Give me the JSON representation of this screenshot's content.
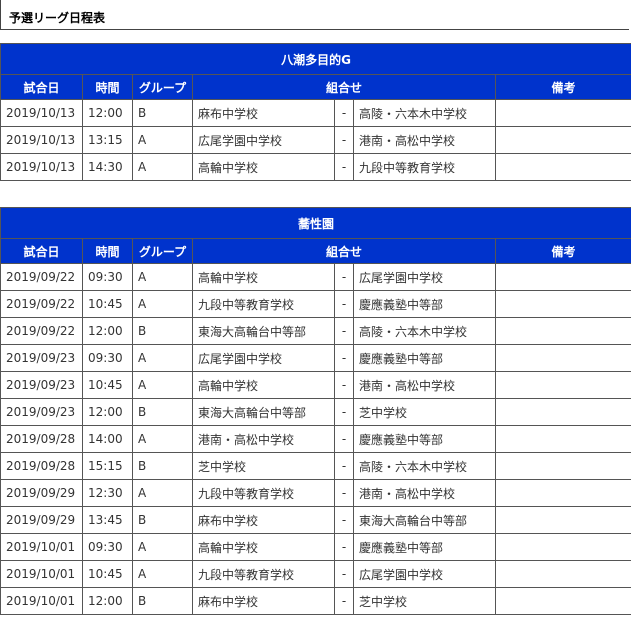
{
  "page_title": "予選リーグ日程表",
  "headers": {
    "date": "試合日",
    "time": "時間",
    "group": "グループ",
    "match": "組合せ",
    "note": "備考"
  },
  "venues": [
    {
      "name": "八潮多目的G",
      "rows": [
        {
          "date": "2019/10/13",
          "time": "12:00",
          "group": "B",
          "team1": "麻布中学校",
          "sep": "-",
          "team2": "高陵・六本木中学校",
          "note": ""
        },
        {
          "date": "2019/10/13",
          "time": "13:15",
          "group": "A",
          "team1": "広尾学園中学校",
          "sep": "-",
          "team2": "港南・高松中学校",
          "note": ""
        },
        {
          "date": "2019/10/13",
          "time": "14:30",
          "group": "A",
          "team1": "高輪中学校",
          "sep": "-",
          "team2": "九段中等教育学校",
          "note": ""
        }
      ]
    },
    {
      "name": "蕎性園",
      "rows": [
        {
          "date": "2019/09/22",
          "time": "09:30",
          "group": "A",
          "team1": "高輪中学校",
          "sep": "-",
          "team2": "広尾学園中学校",
          "note": ""
        },
        {
          "date": "2019/09/22",
          "time": "10:45",
          "group": "A",
          "team1": "九段中等教育学校",
          "sep": "-",
          "team2": "慶應義塾中等部",
          "note": ""
        },
        {
          "date": "2019/09/22",
          "time": "12:00",
          "group": "B",
          "team1": "東海大高輪台中等部",
          "sep": "-",
          "team2": "高陵・六本木中学校",
          "note": ""
        },
        {
          "date": "2019/09/23",
          "time": "09:30",
          "group": "A",
          "team1": "広尾学園中学校",
          "sep": "-",
          "team2": "慶應義塾中等部",
          "note": ""
        },
        {
          "date": "2019/09/23",
          "time": "10:45",
          "group": "A",
          "team1": "高輪中学校",
          "sep": "-",
          "team2": "港南・高松中学校",
          "note": ""
        },
        {
          "date": "2019/09/23",
          "time": "12:00",
          "group": "B",
          "team1": "東海大高輪台中等部",
          "sep": "-",
          "team2": "芝中学校",
          "note": ""
        },
        {
          "date": "2019/09/28",
          "time": "14:00",
          "group": "A",
          "team1": "港南・高松中学校",
          "sep": "-",
          "team2": "慶應義塾中等部",
          "note": ""
        },
        {
          "date": "2019/09/28",
          "time": "15:15",
          "group": "B",
          "team1": "芝中学校",
          "sep": "-",
          "team2": "高陵・六本木中学校",
          "note": ""
        },
        {
          "date": "2019/09/29",
          "time": "12:30",
          "group": "A",
          "team1": "九段中等教育学校",
          "sep": "-",
          "team2": "港南・高松中学校",
          "note": ""
        },
        {
          "date": "2019/09/29",
          "time": "13:45",
          "group": "B",
          "team1": "麻布中学校",
          "sep": "-",
          "team2": "東海大高輪台中等部",
          "note": ""
        },
        {
          "date": "2019/10/01",
          "time": "09:30",
          "group": "A",
          "team1": "高輪中学校",
          "sep": "-",
          "team2": "慶應義塾中等部",
          "note": ""
        },
        {
          "date": "2019/10/01",
          "time": "10:45",
          "group": "A",
          "team1": "九段中等教育学校",
          "sep": "-",
          "team2": "広尾学園中学校",
          "note": ""
        },
        {
          "date": "2019/10/01",
          "time": "12:00",
          "group": "B",
          "team1": "麻布中学校",
          "sep": "-",
          "team2": "芝中学校",
          "note": ""
        }
      ]
    }
  ]
}
